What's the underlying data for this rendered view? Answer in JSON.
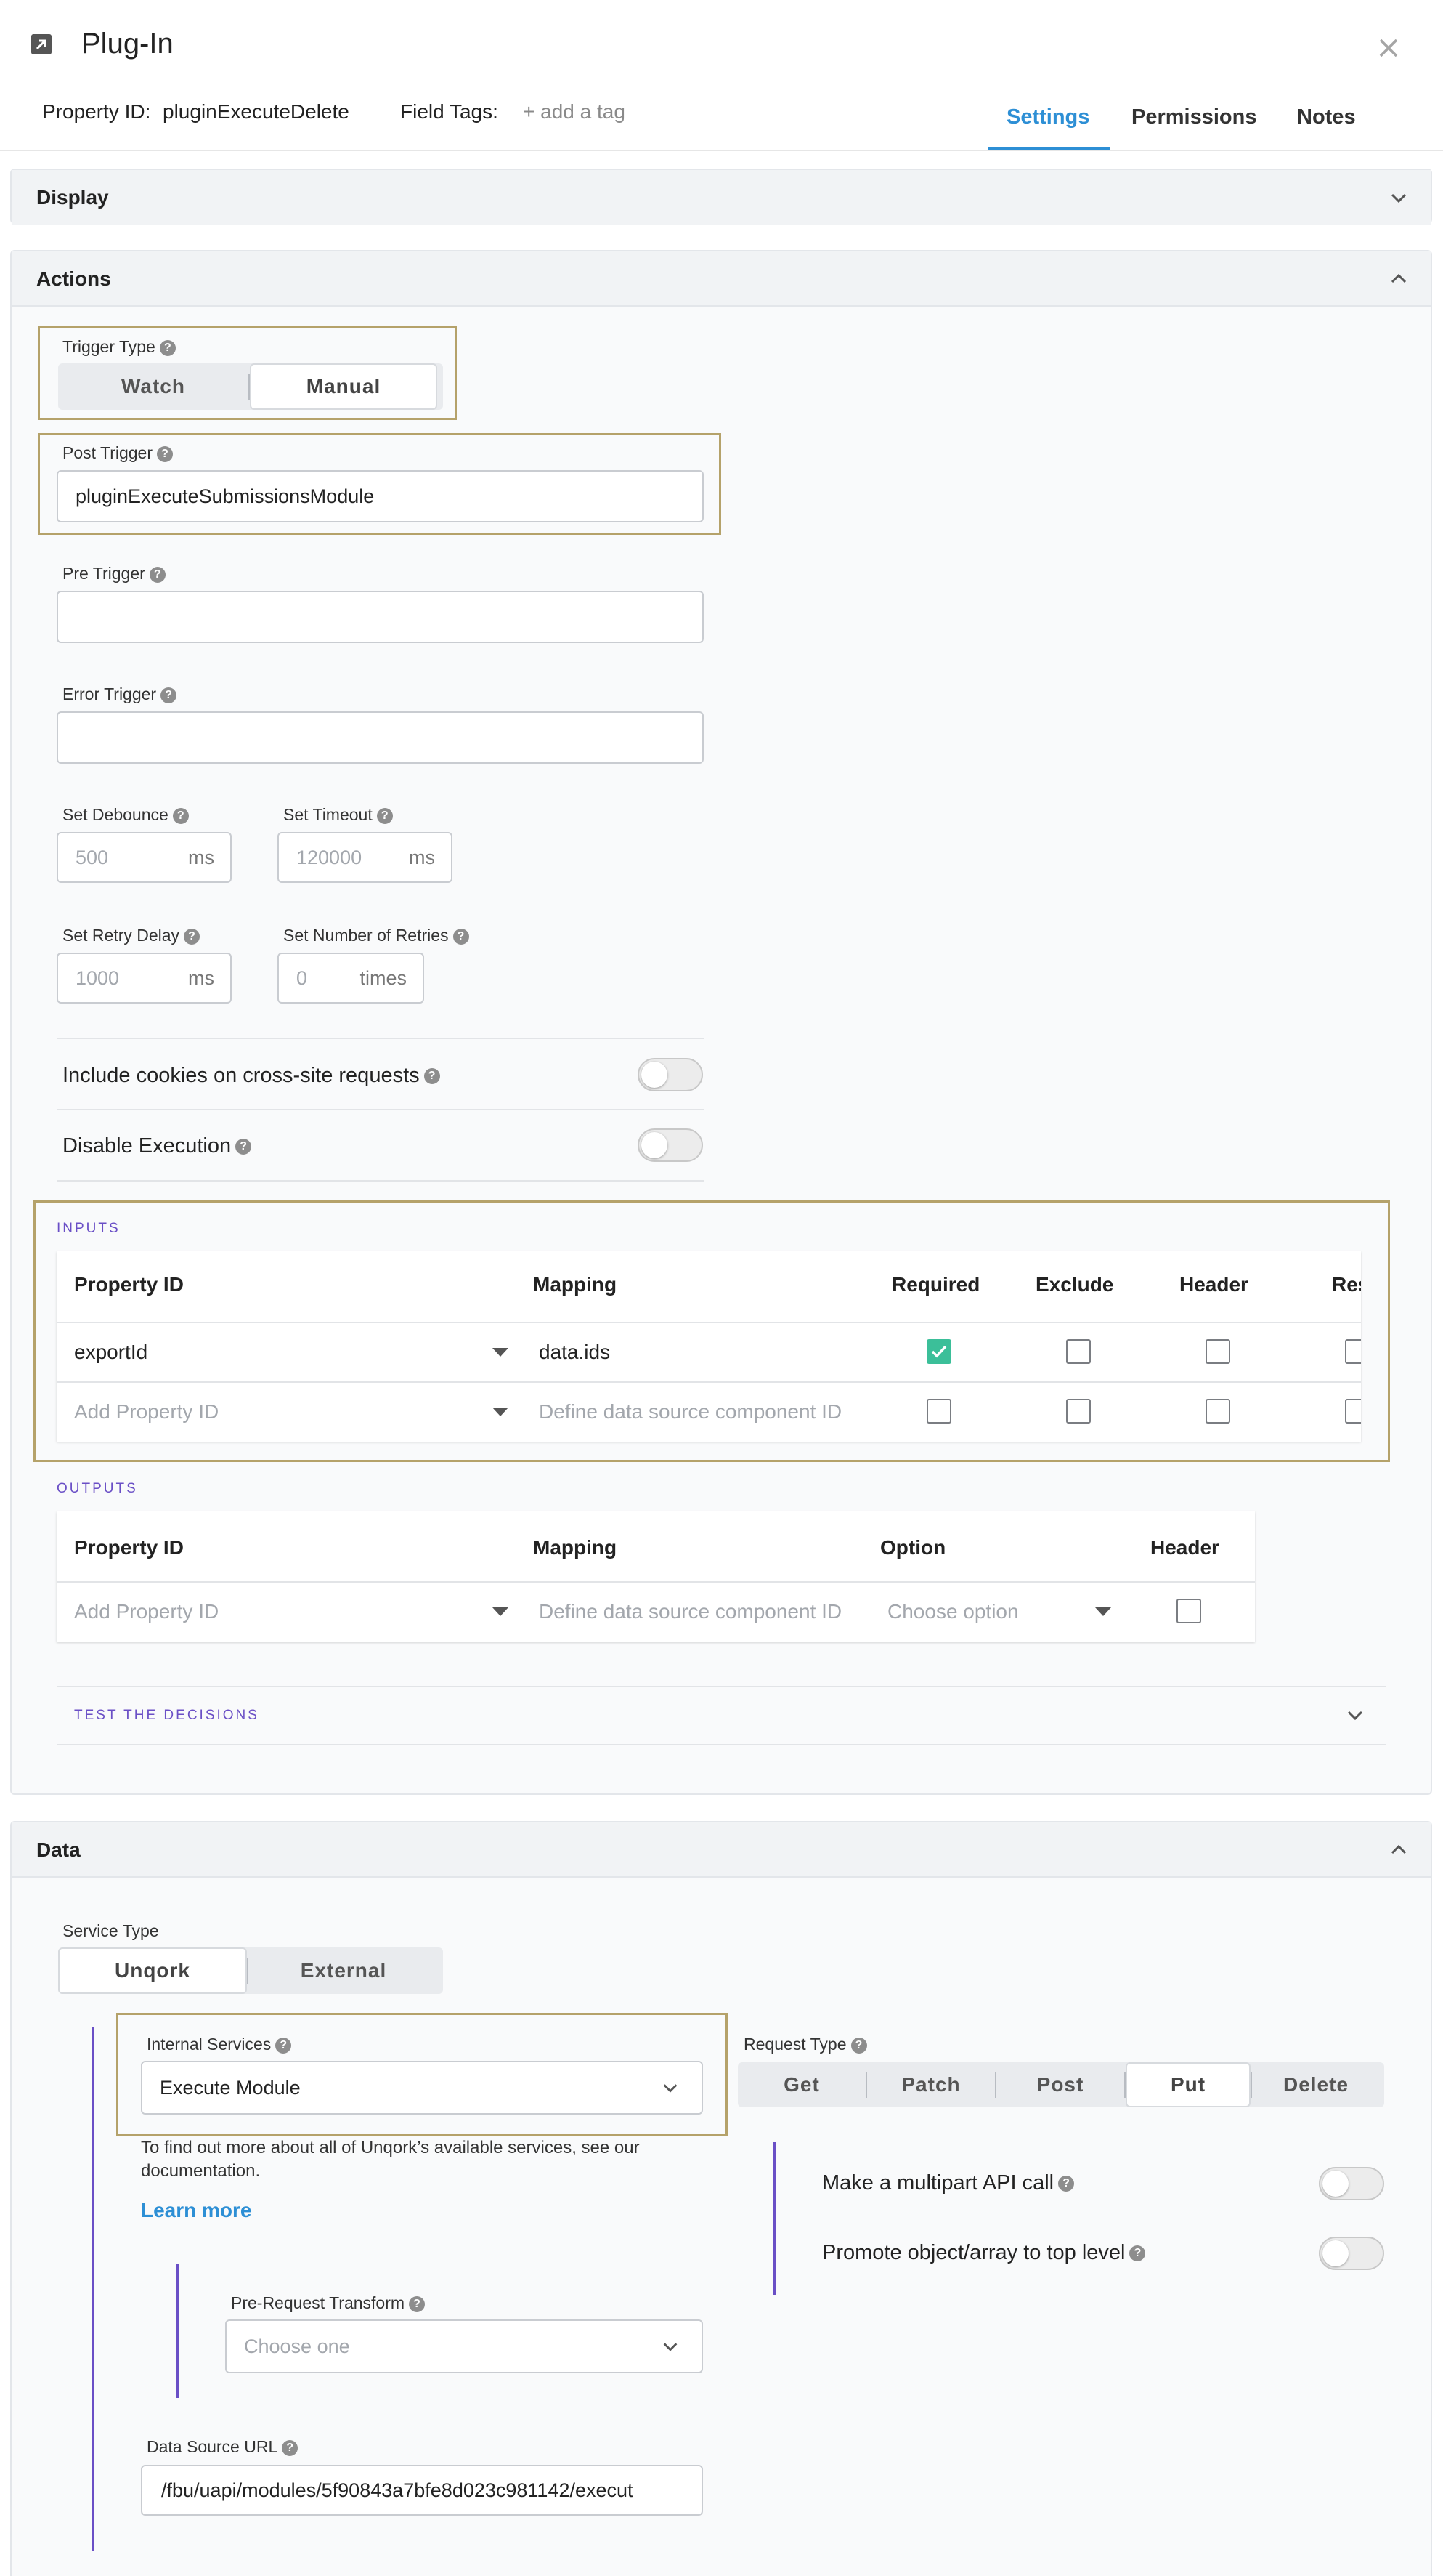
{
  "header": {
    "title": "Plug-In",
    "property_id_label": "Property ID:",
    "property_id_value": "pluginExecuteDelete",
    "field_tags_label": "Field Tags:",
    "add_tag": "+ add a tag",
    "tabs": [
      "Settings",
      "Permissions",
      "Notes"
    ],
    "active_tab": "Settings"
  },
  "background_ghost": {
    "text_1": "pluginExecuteSubmissionsModule"
  },
  "panels": {
    "display": "Display",
    "actions": "Actions",
    "data": "Data"
  },
  "actions": {
    "trigger_type_label": "Trigger Type",
    "trigger_options": [
      "Watch",
      "Manual"
    ],
    "trigger_selected": "Manual",
    "post_trigger_label": "Post Trigger",
    "post_trigger_value": "pluginExecuteSubmissionsModule",
    "pre_trigger_label": "Pre Trigger",
    "pre_trigger_value": "",
    "error_trigger_label": "Error Trigger",
    "error_trigger_value": "",
    "debounce_label": "Set Debounce",
    "debounce_placeholder": "500",
    "debounce_unit": "ms",
    "timeout_label": "Set Timeout",
    "timeout_placeholder": "120000",
    "timeout_unit": "ms",
    "retry_delay_label": "Set Retry Delay",
    "retry_delay_placeholder": "1000",
    "retry_delay_unit": "ms",
    "retries_label": "Set Number of Retries",
    "retries_placeholder": "0",
    "retries_unit": "times",
    "cookies_label": "Include cookies on cross-site requests",
    "disable_label": "Disable Execution"
  },
  "inputs": {
    "section_label": "INPUTS",
    "columns": [
      "Property ID",
      "Mapping",
      "Required",
      "Exclude",
      "Header",
      "Resolve"
    ],
    "rows": [
      {
        "property_id": "exportId",
        "mapping": "data.ids",
        "required": true,
        "exclude": false,
        "header": false,
        "resolve": false,
        "placeholder_row": false
      },
      {
        "property_id": "Add Property ID",
        "mapping": "Define data source component ID",
        "required": false,
        "exclude": false,
        "header": false,
        "resolve": false,
        "placeholder_row": true
      }
    ]
  },
  "outputs": {
    "section_label": "OUTPUTS",
    "columns": [
      "Property ID",
      "Mapping",
      "Option",
      "Header"
    ],
    "rows": [
      {
        "property_id": "Add Property ID",
        "mapping": "Define data source component ID",
        "option": "Choose option",
        "header": false
      }
    ]
  },
  "test_decisions": "TEST THE DECISIONS",
  "data": {
    "service_type_label": "Service Type",
    "service_options": [
      "Unqork",
      "External"
    ],
    "service_selected": "Unqork",
    "internal_services_label": "Internal Services",
    "internal_services_value": "Execute Module",
    "info_text_line1": "To find out more about all of Unqork’s available services, see our",
    "info_text_line2": "documentation.",
    "learn_more": "Learn more",
    "request_type_label": "Request Type",
    "request_options": [
      "Get",
      "Patch",
      "Post",
      "Put",
      "Delete"
    ],
    "request_selected": "Put",
    "multipart_label": "Make a multipart API call",
    "promote_label": "Promote object/array to top level",
    "pre_request_label": "Pre-Request Transform",
    "pre_request_placeholder": "Choose one",
    "data_source_label": "Data Source URL",
    "data_source_value": "/fbu/uapi/modules/5f90843a7bfe8d023c981142/execut"
  },
  "colors": {
    "accent_blue": "#2d8fd5",
    "highlight_border": "#b5a26a",
    "section_purple": "#6a4fc6",
    "checkbox_green": "#3bbf99"
  }
}
